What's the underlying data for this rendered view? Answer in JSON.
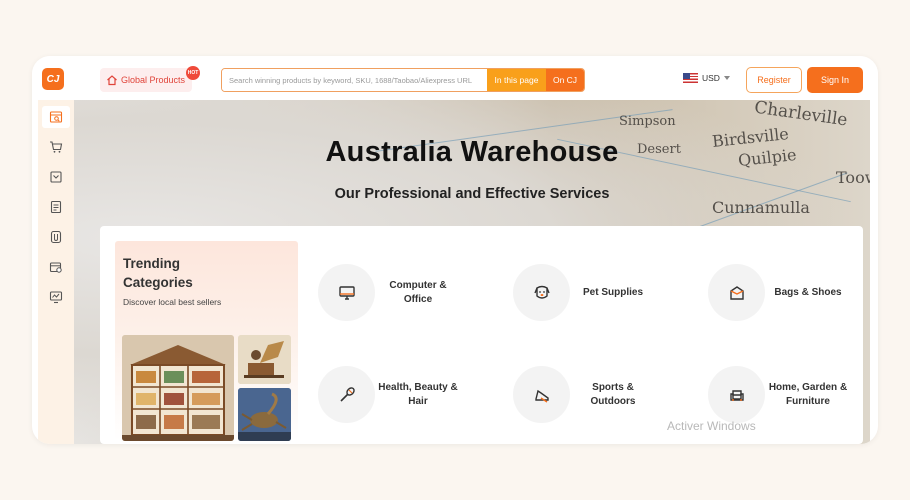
{
  "header": {
    "logo_text": "CJ",
    "global_products_label": "Global Products",
    "hot_badge": "HOT",
    "search_placeholder": "Search winning products by keyword, SKU, 1688/Taobao/Aliexpress URL",
    "search_in_page_label": "In this page",
    "search_on_cj_label": "On CJ",
    "currency": "USD",
    "register_label": "Register",
    "signin_label": "Sign In"
  },
  "sidebar": {
    "items": [
      {
        "icon": "store-search-icon",
        "active": true
      },
      {
        "icon": "cart-icon",
        "active": false
      },
      {
        "icon": "inbox-icon",
        "active": false
      },
      {
        "icon": "orders-list-icon",
        "active": false
      },
      {
        "icon": "paperclip-icon",
        "active": false
      },
      {
        "icon": "settings-store-icon",
        "active": false
      },
      {
        "icon": "monitor-chart-icon",
        "active": false
      }
    ]
  },
  "hero": {
    "title": "Australia Warehouse",
    "subtitle": "Our Professional and Effective Services",
    "map_words": [
      "Charleville",
      "Simpson",
      "Birdsville",
      "Quilpie",
      "Desert",
      "Cunnamulla",
      "Toow"
    ]
  },
  "trending": {
    "title": "Trending Categories",
    "description": "Discover local best sellers"
  },
  "categories": [
    {
      "label": "Computer & Office",
      "icon": "monitor-icon"
    },
    {
      "label": "Pet Supplies",
      "icon": "dog-icon"
    },
    {
      "label": "Bags & Shoes",
      "icon": "bag-icon"
    },
    {
      "label": "Health, Beauty & Hair",
      "icon": "brush-icon"
    },
    {
      "label": "Sports & Outdoors",
      "icon": "sneaker-icon"
    },
    {
      "label": "Home, Garden & Furniture",
      "icon": "armchair-icon"
    }
  ],
  "watermark": "Activer Windows",
  "colors": {
    "accent": "#f56f1d",
    "accent_light": "#f9a01b",
    "background": "#fbf6f0"
  }
}
